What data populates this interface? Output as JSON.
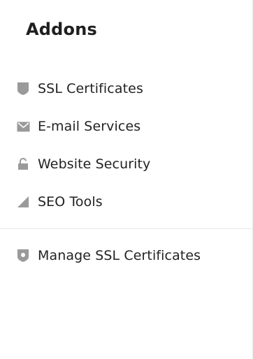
{
  "panel": {
    "title": "Addons"
  },
  "menu": {
    "items": [
      {
        "label": "SSL Certificates",
        "icon": "shield-icon"
      },
      {
        "label": "E-mail Services",
        "icon": "envelope-icon"
      },
      {
        "label": "Website Security",
        "icon": "padlock-icon"
      },
      {
        "label": "SEO Tools",
        "icon": "signal-triangle-icon"
      }
    ],
    "secondary": [
      {
        "label": "Manage SSL Certificates",
        "icon": "shield-badge-icon"
      }
    ]
  },
  "colors": {
    "icon": "#9a9a9a",
    "text": "#222222",
    "divider": "#e6e6e6"
  }
}
